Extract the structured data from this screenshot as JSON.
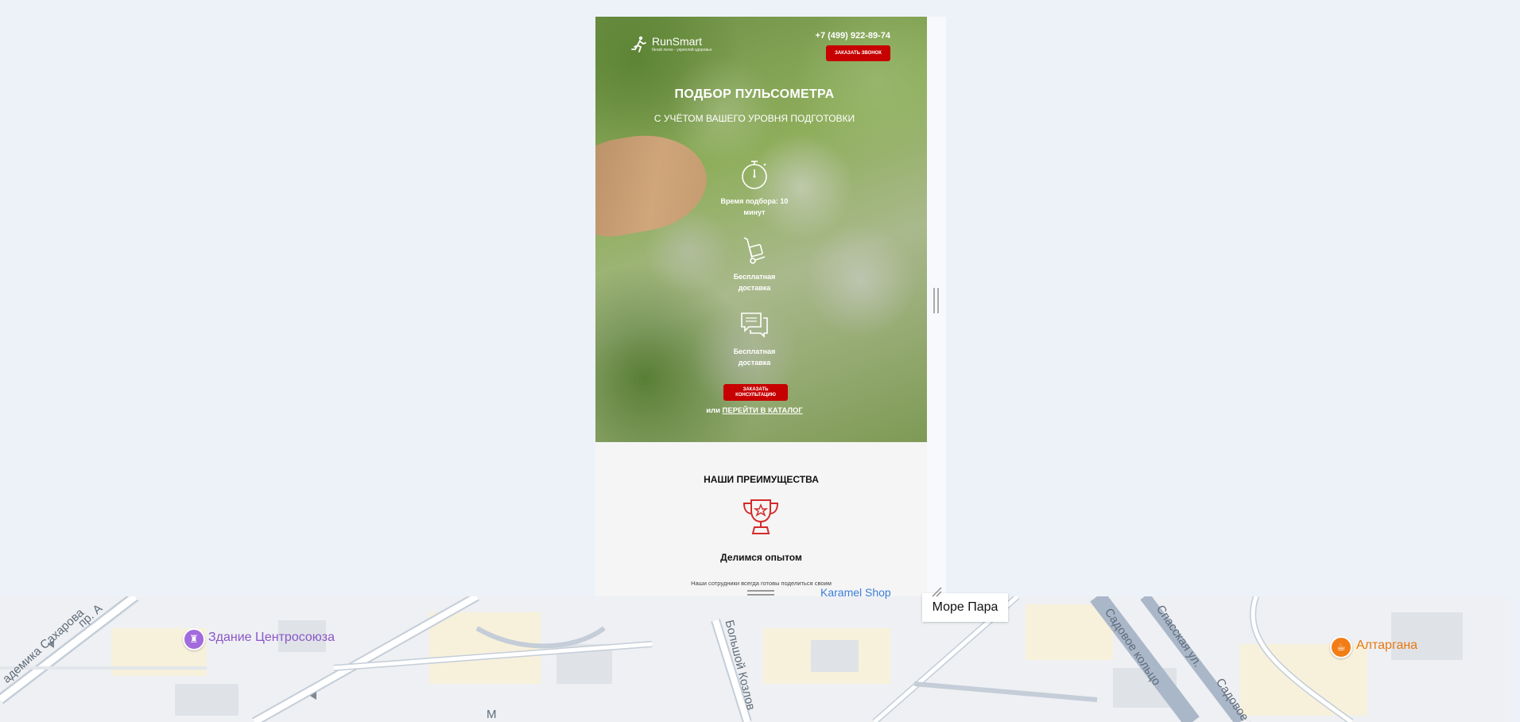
{
  "device": {
    "header": {
      "logo_title": "RunSmart",
      "logo_subtitle": "бегай легко - укрепляй здоровье",
      "phone": "+7 (499) 922-89-74",
      "callback_button": "ЗАКАЗАТЬ ЗВОНОК"
    },
    "hero": {
      "title": "ПОДБОР ПУЛЬСОМЕТРА",
      "subtitle": "С УЧЁТОМ ВАШЕГО УРОВНЯ ПОДГОТОВКИ",
      "features": [
        {
          "icon": "stopwatch-icon",
          "line1": "Время подбора: 10",
          "line2": "минут"
        },
        {
          "icon": "hand-truck-icon",
          "line1": "Бесплатная",
          "line2": "доставка"
        },
        {
          "icon": "chat-bubbles-icon",
          "line1": "Бесплатная",
          "line2": "доставка"
        }
      ],
      "consult_button": "ЗАКАЗАТЬ КОНСУЛЬТАЦИЮ",
      "or_text": "или",
      "catalog_link": "ПЕРЕЙТИ В КАТАЛОГ"
    },
    "advantages": {
      "title": "НАШИ ПРЕИМУЩЕСТВА",
      "icon": "trophy-icon",
      "item_title": "Делимся опытом",
      "item_text": "Наши сотрудники всегда готовы поделиться своим"
    }
  },
  "map": {
    "places": {
      "centrosoyuz": "Здание Центросоюза",
      "altargana": "Алтаргана",
      "karamel_shop": "Karamel Shop",
      "more_para": "Море Пара"
    },
    "streets": {
      "sakharova": "адемика Сахарова",
      "pr": "пр. А",
      "kozlovsky": "Большой Козлов",
      "sadovoe_koltso": "Садовое кольцо",
      "spasskaya": "Спасская ул.",
      "sadovoe2": "Садовое к",
      "m": "М"
    },
    "colors": {
      "poi": "#8b55c7",
      "cafe": "#e8770f",
      "road_major": "#aab7c9"
    }
  },
  "colors": {
    "accent_red": "#c70101",
    "page_bg": "#edf2f8"
  }
}
